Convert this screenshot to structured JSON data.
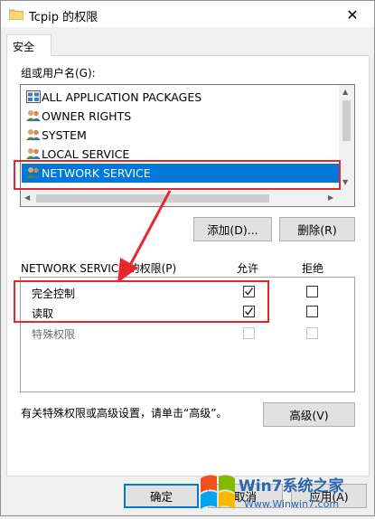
{
  "window": {
    "title": "Tcpip 的权限",
    "close_glyph": "✕"
  },
  "tabs": [
    {
      "label": "安全"
    }
  ],
  "groups": {
    "label": "组或用户名(G):",
    "items": [
      {
        "label": "ALL APPLICATION PACKAGES",
        "icon": "app-packages-icon"
      },
      {
        "label": "OWNER RIGHTS",
        "icon": "users-icon"
      },
      {
        "label": "SYSTEM",
        "icon": "users-icon"
      },
      {
        "label": "LOCAL SERVICE",
        "icon": "users-icon"
      },
      {
        "label": "NETWORK SERVICE",
        "icon": "users-icon",
        "selected": true
      }
    ]
  },
  "buttons": {
    "add": "添加(D)...",
    "remove": "删除(R)",
    "advanced": "高级(V)",
    "ok": "确定",
    "cancel": "取消",
    "apply": "应用(A)"
  },
  "permissions": {
    "header": "NETWORK SERVICE 的权限(P)",
    "allow_header": "允许",
    "deny_header": "拒绝",
    "rows": [
      {
        "label": "完全控制",
        "allow": true,
        "deny": false,
        "enabled": true
      },
      {
        "label": "读取",
        "allow": true,
        "deny": false,
        "enabled": true
      },
      {
        "label": "特殊权限",
        "allow": false,
        "deny": false,
        "enabled": false
      }
    ]
  },
  "advanced_hint": "有关特殊权限或高级设置，请单击“高级”。",
  "watermark": {
    "brand": "Win7系统之家",
    "url": "Www.Winwin7.com"
  },
  "colors": {
    "selection": "#0078d7",
    "annotation": "#e8262d"
  }
}
